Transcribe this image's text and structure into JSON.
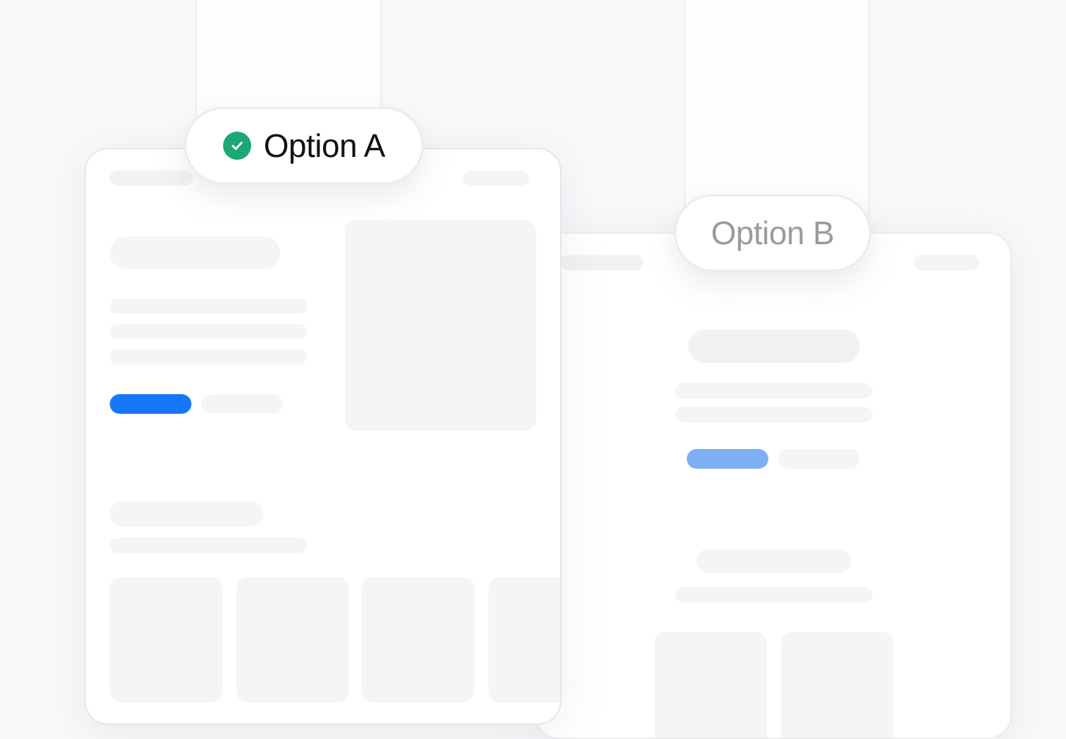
{
  "options": [
    {
      "label": "Option A",
      "selected": true,
      "icon": "check-circle-icon",
      "label_color": "#111111",
      "icon_color": "#1aa874"
    },
    {
      "label": "Option B",
      "selected": false,
      "label_color": "#9a9a9f"
    }
  ],
  "colors": {
    "background": "#f9f9fb",
    "card": "#ffffff",
    "skeleton": "#f2f2f4",
    "primary_button": "#1877f8",
    "primary_button_muted": "#7fb0f6"
  }
}
